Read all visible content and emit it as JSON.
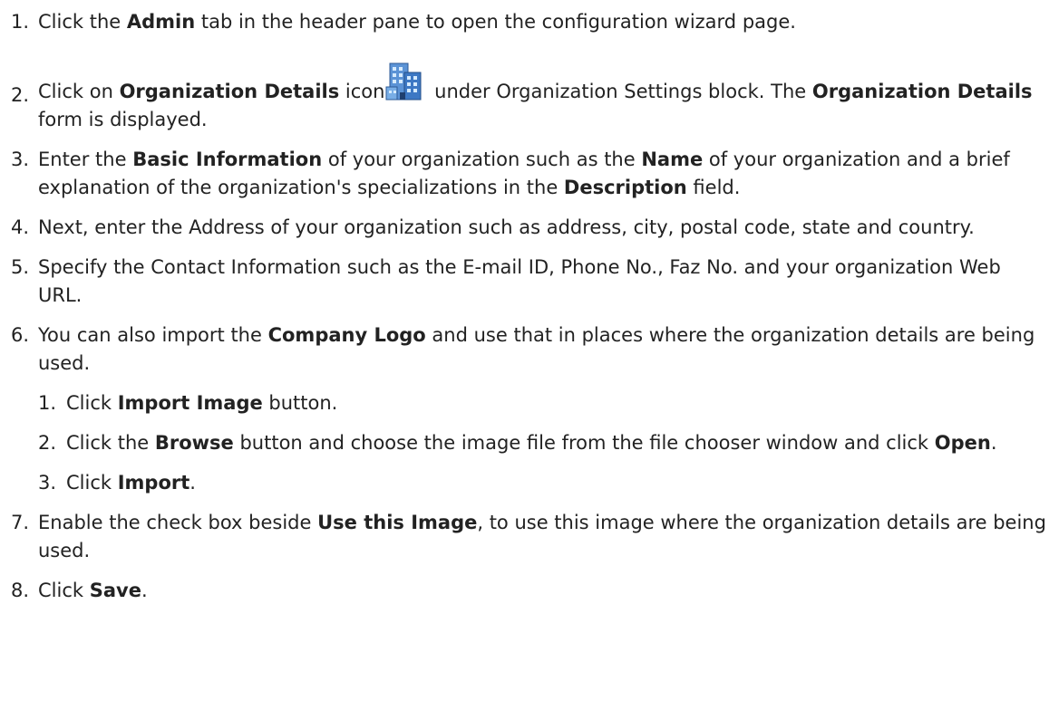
{
  "steps": [
    {
      "num": "1.",
      "parts": [
        "Click the ",
        "Admin",
        " tab in the header pane to open the configuration wizard page."
      ]
    },
    {
      "num": "2.",
      "parts": [
        "Click on ",
        "Organization Details",
        " icon",
        " under Organization Settings block. The ",
        "Organization Details",
        " form is displayed."
      ]
    },
    {
      "num": "3.",
      "parts": [
        "Enter the ",
        "Basic Information",
        " of your organization such as the ",
        "Name",
        " of your organization and a brief explanation of the organization's specializations in the ",
        "Description",
        " field."
      ]
    },
    {
      "num": "4.",
      "text": "Next, enter the Address of your organization such as address, city, postal code, state and country."
    },
    {
      "num": "5.",
      "text": "Specify the Contact Information such as the E-mail ID, Phone No., Faz No. and your organization Web URL."
    },
    {
      "num": "6.",
      "parts": [
        "You can also import the ",
        "Company Logo",
        " and use that in places where the organization details are being used."
      ]
    },
    {
      "num": "7.",
      "parts": [
        "Enable the check box beside ",
        "Use this Image",
        ", to use this image where the organization details are being used."
      ]
    },
    {
      "num": "8.",
      "parts": [
        "Click ",
        "Save",
        "."
      ]
    }
  ],
  "substeps": [
    {
      "num": "1.",
      "parts": [
        "Click ",
        "Import Image",
        " button."
      ]
    },
    {
      "num": "2.",
      "parts": [
        "Click the ",
        "Browse",
        " button and choose the image file from the file chooser window and click ",
        "Open",
        "."
      ]
    },
    {
      "num": "3.",
      "parts": [
        "Click ",
        "Import",
        "."
      ]
    }
  ],
  "icons": {
    "org_details": "organization-building-icon"
  },
  "colors": {
    "text": "#222222",
    "icon_blue": "#3d78c4",
    "icon_light": "#a8cdf0"
  }
}
